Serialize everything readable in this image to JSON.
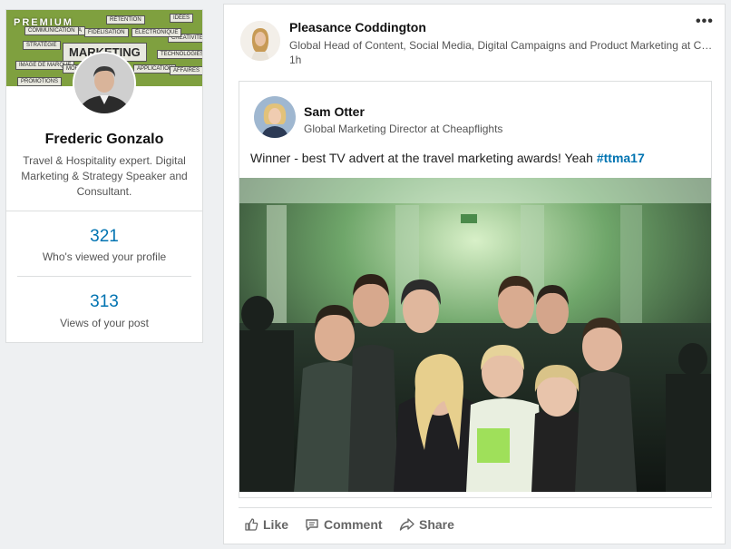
{
  "profile": {
    "premium_label": "PREMIUM",
    "name": "Frederic Gonzalo",
    "headline": "Travel & Hospitality expert. Digital Marketing & Strategy Speaker and Consultant.",
    "banner_words": [
      "MARKETING",
      "STRATÉGIE",
      "MÉDIA",
      "FIDÉLISATION",
      "RÉTENTION",
      "IDÉES",
      "CRÉATIVITÉ",
      "ÉLECTRONIQUE",
      "TECHNOLOGIES",
      "IMAGE DE MARQUE",
      "MOBILE",
      "APPLICATION",
      "AFFAIRES",
      "PROMOTIONS",
      "COMMUNICATION"
    ],
    "stats": [
      {
        "value": "321",
        "label": "Who's viewed your profile"
      },
      {
        "value": "313",
        "label": "Views of your post"
      }
    ]
  },
  "post": {
    "actor_name": "Pleasance Coddington",
    "actor_headline": "Global Head of Content, Social Media, Digital Campaigns and Product Marketing at Cheapflights",
    "time": "1h",
    "more_label": "•••",
    "shared": {
      "author_name": "Sam Otter",
      "author_headline": "Global Marketing Director at Cheapflights",
      "text": "Winner - best TV advert at the travel marketing awards! Yeah ",
      "hashtag": "#ttma17"
    },
    "actions": {
      "like": "Like",
      "comment": "Comment",
      "share": "Share"
    }
  },
  "colors": {
    "link": "#0073b1",
    "page_bg": "#eef0f2",
    "banner_green": "#7fa03f"
  },
  "icons": [
    "like-icon",
    "comment-icon",
    "share-icon",
    "more-icon"
  ]
}
